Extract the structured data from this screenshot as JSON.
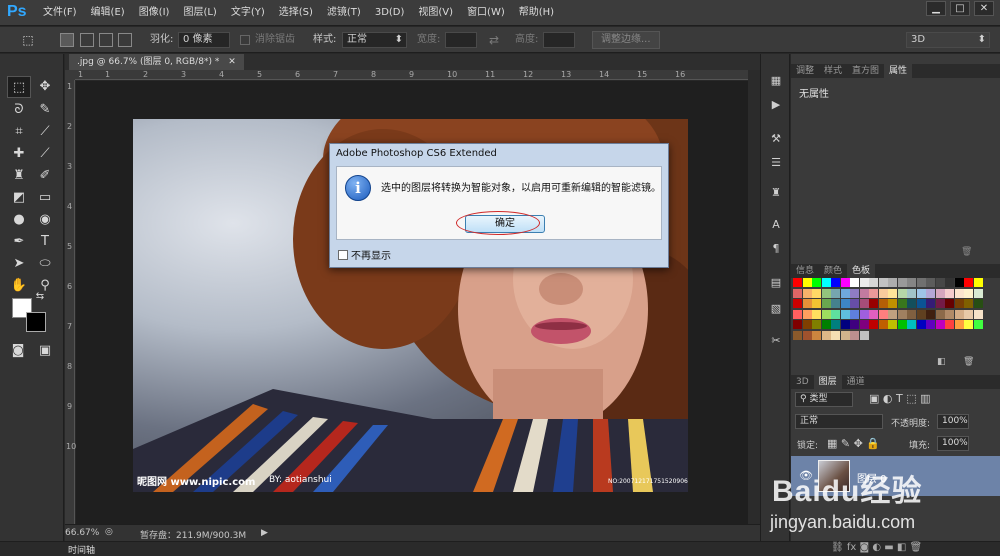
{
  "app": {
    "logo": "Ps"
  },
  "menu": [
    "文件(F)",
    "编辑(E)",
    "图像(I)",
    "图层(L)",
    "文字(Y)",
    "选择(S)",
    "滤镜(T)",
    "3D(D)",
    "视图(V)",
    "窗口(W)",
    "帮助(H)"
  ],
  "window_controls": {
    "minimize": "▁",
    "maximize": "□",
    "close": "✕"
  },
  "options": {
    "feather_label": "羽化:",
    "feather_value": "0 像素",
    "antialias_label": "消除锯齿",
    "style_label": "样式:",
    "style_value": "正常",
    "width_label": "宽度:",
    "height_label": "高度:",
    "refine_edge_button": "调整边缘...",
    "workspace_value": "3D"
  },
  "document": {
    "tab_title": ".jpg @ 66.7% (图层 0, RGB/8*) *",
    "tab_close": "✕",
    "watermark_site": "昵图网 www.nipic.com",
    "watermark_author": "BY: aotianshui",
    "watermark_id": "NO:20071217175152090643"
  },
  "ruler_top": [
    "1",
    "1",
    "2",
    "3",
    "4",
    "5",
    "6",
    "7",
    "8",
    "9",
    "10",
    "11",
    "12",
    "13",
    "14",
    "15",
    "16"
  ],
  "ruler_left": [
    "1",
    "2",
    "3",
    "4",
    "5",
    "6",
    "7",
    "8",
    "9",
    "10"
  ],
  "status": {
    "zoom": "66.67%",
    "scratch": "暂存盘：211.9M/900.3M",
    "arrow": "▶"
  },
  "timeline": {
    "label": "时间轴"
  },
  "panels": {
    "top_tabs": [
      "调整",
      "样式",
      "直方图",
      "属性"
    ],
    "top_active": 3,
    "properties_text": "无属性",
    "mid_tabs": [
      "信息",
      "颜色",
      "色板"
    ],
    "mid_active": 2,
    "layer_tabs": [
      "3D",
      "图层",
      "通道"
    ],
    "layer_active": 1,
    "filter_kind": "类型",
    "blend_mode": "正常",
    "opacity_label": "不透明度:",
    "opacity_value": "100%",
    "lock_label": "锁定:",
    "fill_label": "填充:",
    "fill_value": "100%",
    "layer_name": "图层 0"
  },
  "dialog": {
    "title": "Adobe Photoshop CS6 Extended",
    "message": "选中的图层将转换为智能对象，以启用可重新编辑的智能滤镜。",
    "info_glyph": "i",
    "ok_button": "确定",
    "dont_show_label": "不再显示"
  },
  "page_watermark": {
    "text": "Baidu经验",
    "url": "jingyan.baidu.com"
  },
  "swatch_colors": [
    "#ff0000",
    "#ffff00",
    "#00ff00",
    "#00ffff",
    "#0000ff",
    "#ff00ff",
    "#ffffff",
    "#ebebeb",
    "#d6d6d6",
    "#c2c2c2",
    "#adadad",
    "#999999",
    "#858585",
    "#707070",
    "#5c5c5c",
    "#474747",
    "#333333",
    "#000000",
    "#ff0000",
    "#ffff00",
    "#e06666",
    "#f6b26b",
    "#ffd966",
    "#93c47d",
    "#76a5af",
    "#6fa8dc",
    "#8e7cc3",
    "#c27ba0",
    "#ea9999",
    "#f9cb9c",
    "#ffe599",
    "#b6d7a8",
    "#a2c4c9",
    "#9fc5e8",
    "#b4a7d6",
    "#d5a6bd",
    "#f4cccc",
    "#fce5cd",
    "#fff2cc",
    "#d9ead3",
    "#cc0000",
    "#e69138",
    "#f1c232",
    "#6aa84f",
    "#45818e",
    "#3d85c6",
    "#674ea7",
    "#a64d79",
    "#990000",
    "#b45f06",
    "#bf9000",
    "#38761d",
    "#134f5c",
    "#0b5394",
    "#351c75",
    "#741b47",
    "#660000",
    "#783f04",
    "#7f6000",
    "#274e13",
    "#ff5f5f",
    "#ff9f5f",
    "#ffdf5f",
    "#9fdf5f",
    "#5fdf9f",
    "#5fbfdf",
    "#5f7fdf",
    "#9f5fdf",
    "#df5fbf",
    "#ff7f7f",
    "#c0a080",
    "#a08060",
    "#806040",
    "#604020",
    "#402010",
    "#8c6a4a",
    "#b08a68",
    "#d4ad88",
    "#e8c9a8",
    "#f6e2c8",
    "#7f0000",
    "#7f3f00",
    "#7f7f00",
    "#007f00",
    "#007f7f",
    "#00007f",
    "#3f007f",
    "#7f007f",
    "#bf0000",
    "#bf5f00",
    "#bfbf00",
    "#00bf00",
    "#00bfbf",
    "#0000bf",
    "#5f00bf",
    "#bf00bf",
    "#ff4040",
    "#ff9f40",
    "#ffff40",
    "#40ff40",
    "#8b5a2b",
    "#a0522d",
    "#cd853f",
    "#deb887",
    "#f5deb3",
    "#d2b48c",
    "#bc8f8f",
    "#c0c0c0"
  ]
}
